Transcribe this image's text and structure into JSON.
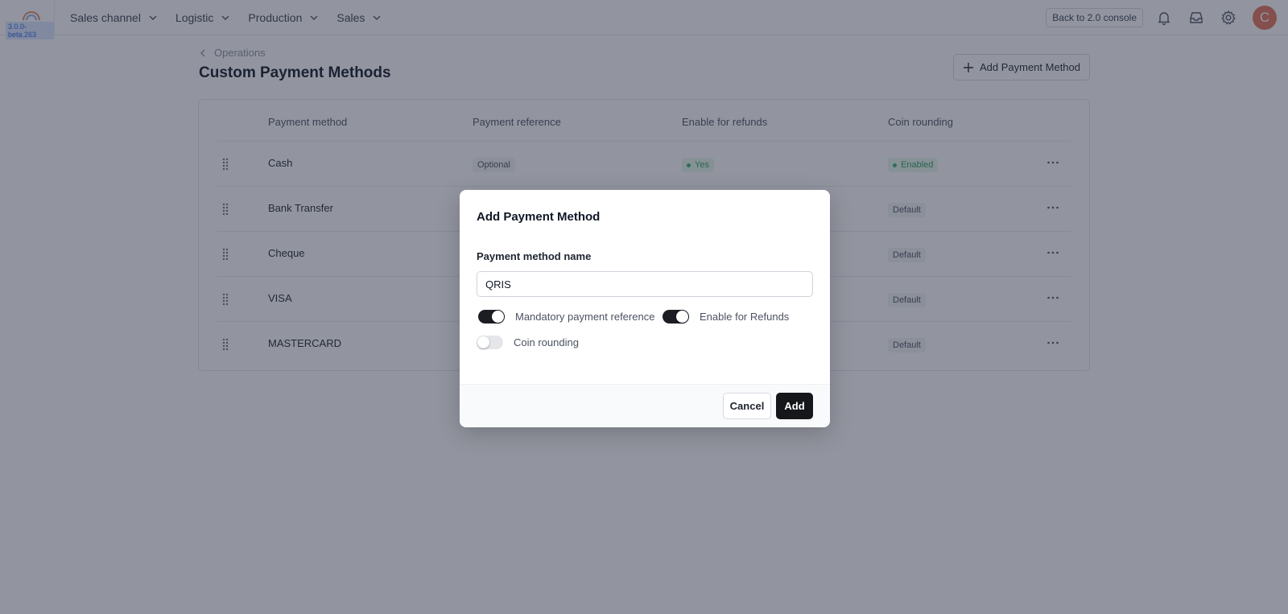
{
  "app": {
    "version": "3.0.0-beta.263",
    "nav": [
      {
        "label": "Sales channel"
      },
      {
        "label": "Logistic"
      },
      {
        "label": "Production"
      },
      {
        "label": "Sales"
      }
    ],
    "console_button": "Back to 2.0 console",
    "avatar_initial": "C"
  },
  "page": {
    "breadcrumb": "Operations",
    "title": "Custom Payment Methods",
    "add_button": "Add Payment Method"
  },
  "table": {
    "columns": [
      "Payment method",
      "Payment reference",
      "Enable for refunds",
      "Coin rounding"
    ],
    "rows": [
      {
        "name": "Cash",
        "reference": "Optional",
        "refunds": "Yes",
        "rounding": "Enabled"
      },
      {
        "name": "Bank Transfer",
        "rounding": "Default"
      },
      {
        "name": "Cheque",
        "rounding": "Default"
      },
      {
        "name": "VISA",
        "rounding": "Default"
      },
      {
        "name": "MASTERCARD",
        "rounding": "Default"
      }
    ]
  },
  "modal": {
    "title": "Add Payment Method",
    "field_label": "Payment method name",
    "field_value": "QRIS",
    "toggles": {
      "mandatory": {
        "label": "Mandatory payment reference",
        "on": true
      },
      "refunds": {
        "label": "Enable for Refunds",
        "on": true
      },
      "rounding": {
        "label": "Coin rounding",
        "on": false
      }
    },
    "cancel": "Cancel",
    "add": "Add"
  },
  "colors": {
    "primary_button": "#15171b",
    "avatar": "#e2725b",
    "success": "#2f9e5b"
  }
}
